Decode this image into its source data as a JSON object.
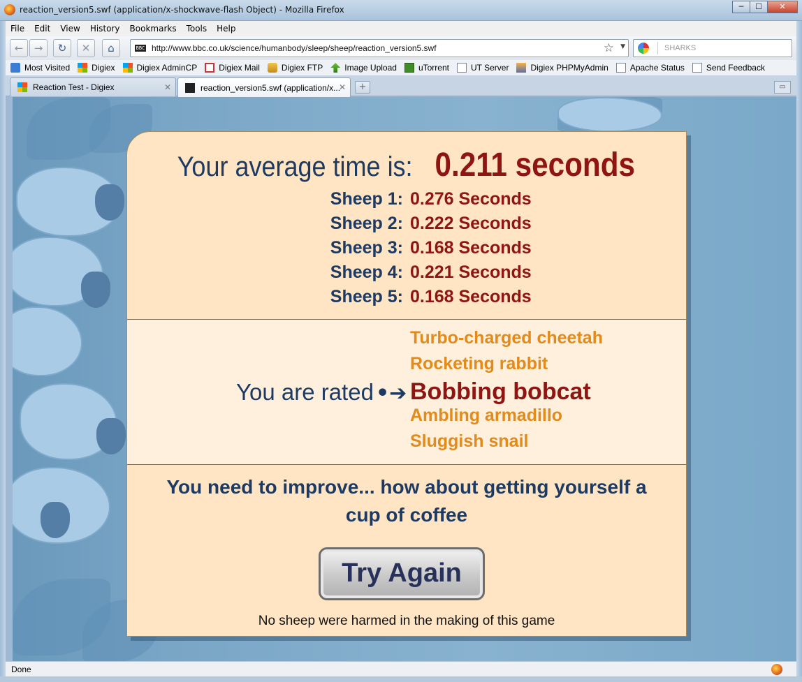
{
  "window": {
    "title": "reaction_version5.swf (application/x-shockwave-flash Object) - Mozilla Firefox",
    "minimize": "─",
    "maximize": "☐",
    "close": "✕"
  },
  "menu": [
    "File",
    "Edit",
    "View",
    "History",
    "Bookmarks",
    "Tools",
    "Help"
  ],
  "nav": {
    "url": "http://www.bbc.co.uk/science/humanbody/sleep/sheep/reaction_version5.swf",
    "url_favicon": "BBC",
    "search_placeholder": "SHARKS"
  },
  "bookmarks": [
    "Most Visited",
    "Digiex",
    "Digiex AdminCP",
    "Digiex Mail",
    "Digiex FTP",
    "Image Upload",
    "uTorrent",
    "UT Server",
    "Digiex PHPMyAdmin",
    "Apache Status",
    "Send Feedback"
  ],
  "tabs": [
    {
      "label": "Reaction Test - Digiex",
      "active": false
    },
    {
      "label": "reaction_version5.swf (application/x...",
      "active": true
    }
  ],
  "status": "Done",
  "game": {
    "average_label": "Your average time is:",
    "average_value": "0.211 seconds",
    "sheep": [
      {
        "label": "Sheep 1:",
        "value": "0.276 Seconds"
      },
      {
        "label": "Sheep 2:",
        "value": "0.222 Seconds"
      },
      {
        "label": "Sheep 3:",
        "value": "0.168 Seconds"
      },
      {
        "label": "Sheep 4:",
        "value": "0.221 Seconds"
      },
      {
        "label": "Sheep 5:",
        "value": "0.168 Seconds"
      }
    ],
    "rated_label": "You are rated",
    "ranks": [
      "Turbo-charged cheetah",
      "Rocketing rabbit",
      "Bobbing bobcat",
      "Ambling armadillo",
      "Sluggish snail"
    ],
    "current_rank": "Bobbing bobcat",
    "advice": "You need to improve... how about getting yourself a cup of coffee",
    "button": "Try Again",
    "footer": "No sheep were harmed in the making of this game"
  },
  "colors": {
    "navy": "#1d3a63",
    "dark_red": "#8e1512",
    "orange": "#e28a1a",
    "panel_bg": "#ffe5c4"
  }
}
